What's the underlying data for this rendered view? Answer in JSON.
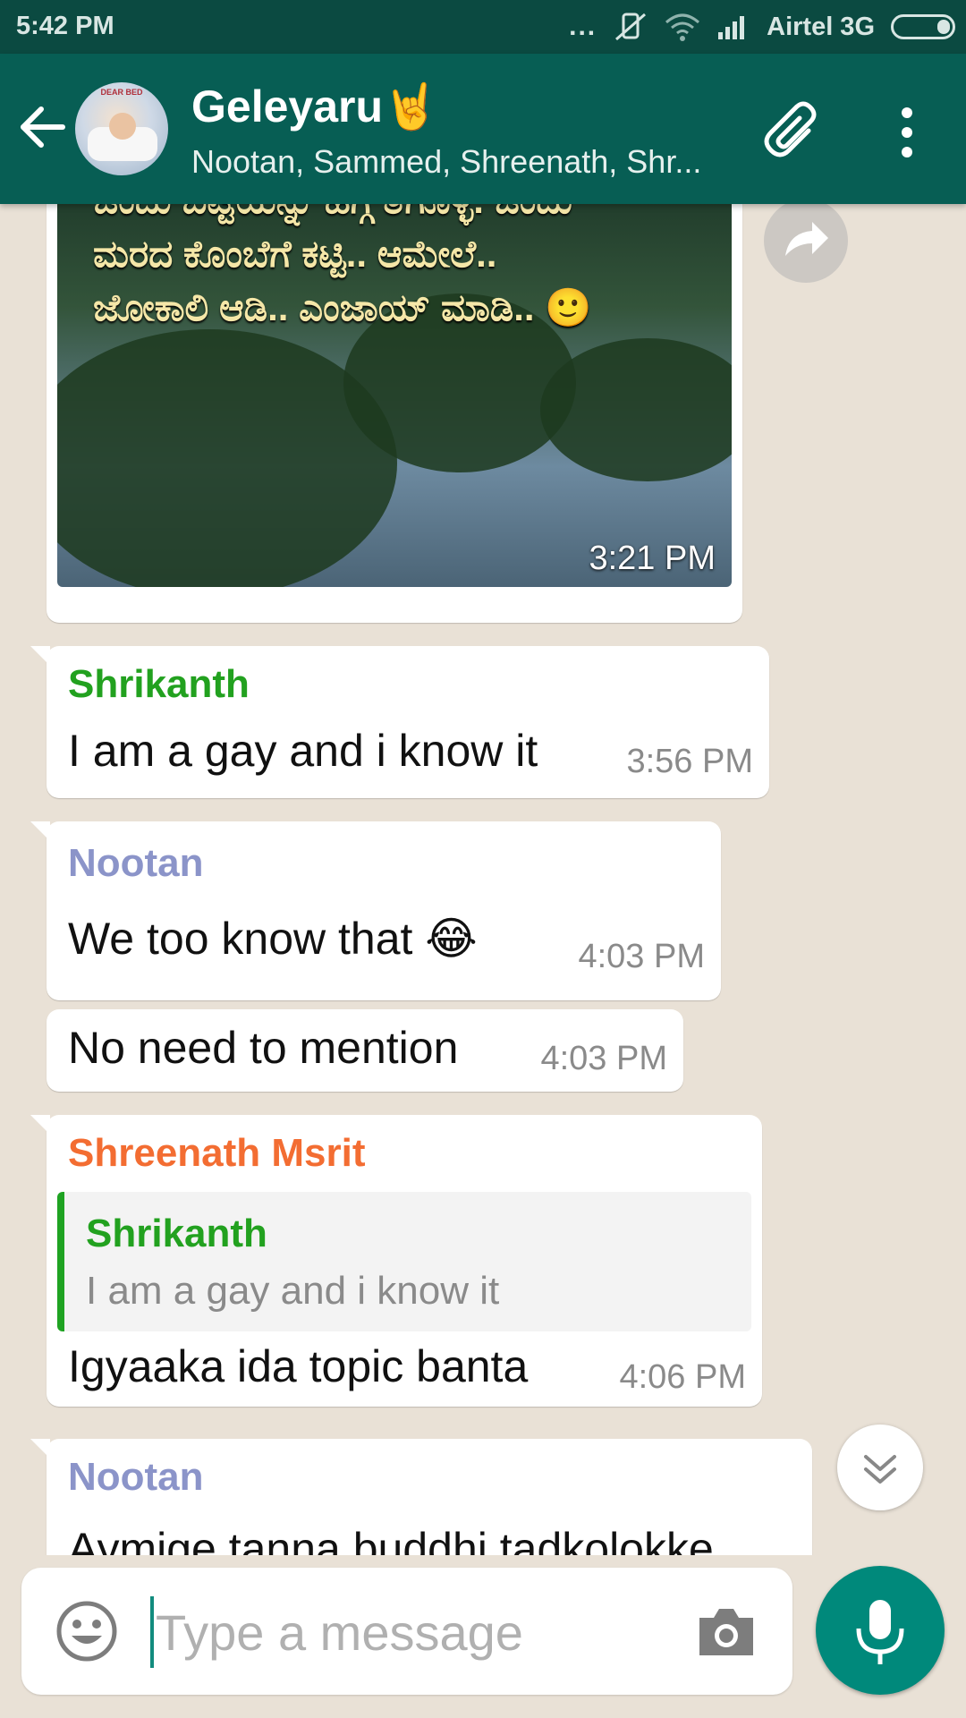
{
  "status_bar": {
    "time": "5:42 PM",
    "carrier": "Airtel 3G",
    "dots": "...",
    "icons": [
      "notification-dots-icon",
      "vibrate-off-icon",
      "wifi-icon",
      "signal-icon",
      "battery-icon"
    ]
  },
  "header": {
    "group_name": "Geleyaru🤘",
    "participants": "Nootan, Sammed, Shreenath, Shr...",
    "avatar_caption": "DEAR BED"
  },
  "image_message": {
    "text_lines": [
      "ಒಂದು ಬಟ್ಟೆಯನ್ನು ಹಗ್ಗ ತೆಗೊಳ್ಳಿ. ಒಂದು",
      "ಮರದ ಕೊಂಬೆಗೆ ಕಟ್ಟಿ.. ಆಮೇಲೆ..",
      "ಜೋಕಾಲಿ ಆಡಿ.. ಎಂಜಾಯ್ ಮಾಡಿ.. 🙂"
    ],
    "time": "3:21 PM"
  },
  "messages": [
    {
      "sender": "Shrikanth",
      "sender_color": "#22a11f",
      "text": "I am a gay and i know it",
      "time": "3:56 PM"
    },
    {
      "sender": "Nootan",
      "sender_color": "#8b94c9",
      "text": "We too know that 😂",
      "time": "4:03 PM"
    },
    {
      "sender": "",
      "text": "No need to mention",
      "time": "4:03 PM"
    },
    {
      "sender": "Shreenath Msrit",
      "sender_color": "#f36d32",
      "quote_sender": "Shrikanth",
      "quote_text": "I am a gay and i know it",
      "text": "Igyaaka ida topic banta",
      "time": "4:06 PM"
    },
    {
      "sender": "Nootan",
      "sender_color": "#8b94c9",
      "text": "Aymige tanna buddhi tadkolokke"
    }
  ],
  "input": {
    "placeholder": "Type a message",
    "value": ""
  },
  "colors": {
    "status_bar": "#0b4a41",
    "header": "#075e54",
    "chat_bg": "#e9e1d6",
    "mic_button": "#00897b"
  }
}
